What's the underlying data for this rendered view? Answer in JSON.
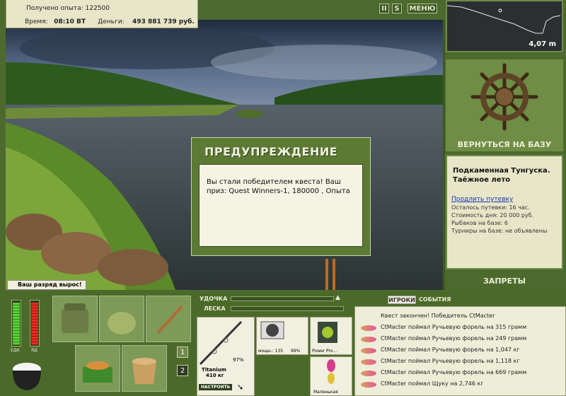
{
  "header": {
    "exp_label": "Получено опыта:",
    "exp_value": "122500",
    "time_label": "Время:",
    "time_value": "08:10 ВТ",
    "money_label": "Деньги:",
    "money_value": "493 881 739 руб."
  },
  "topbar": {
    "pause_icon": "pause-icon",
    "sound_icon": "sound-icon",
    "menu_label": "МЕНЮ"
  },
  "depth": {
    "value": "4,07 m"
  },
  "base": {
    "return_label": "ВЕРНУТЬСЯ НА БАЗУ"
  },
  "location": {
    "name": "Подкаменная Тунгуска. Таёжное лето",
    "extend_link": "Продлить путевку",
    "stats": [
      "Осталось путевки: 16 час.",
      "Стоимость дня: 20 000 руб.",
      "Рыбаков на базе: 6",
      "Турниры на базе: не объявлены"
    ],
    "bans_label": "ЗАПРЕТЫ"
  },
  "dialog": {
    "title": "ПРЕДУПРЕЖДЕНИЕ",
    "message": "Вы стали победителем квеста! Ваш приз: Quest Winners-1, 180000 , Опыта"
  },
  "rank_notice": "Ваш разряд вырос!",
  "gauges": {
    "food_label": "ЕДА",
    "poison_label": "ЯД"
  },
  "pages": [
    "1",
    "2"
  ],
  "rod": {
    "rod_label": "УДОЧКА",
    "line_label": "ЛЕСКА",
    "rod_name": "Titanium",
    "rod_weight": "410 кг",
    "rod_condition": "97%",
    "reel_label": "мощн.: 135",
    "reel_condition": "99%",
    "line_name": "Power Pro...",
    "lure_name": "Маленькая",
    "setup_label": "НАСТРОИТЬ"
  },
  "events": {
    "tabs": [
      "ИГРОКИ",
      "СОБЫТИЯ"
    ],
    "items": [
      "Квест закончен! Победитель CtMacter",
      "CtMacter поймал Ручьевую форель на 315 грамм",
      "CtMacter поймал Ручьевую форель на 249 грамм",
      "CtMacter поймал Ручьевую форель на 1,047 кг",
      "CtMacter поймал Ручьевую форель на 1,118 кг",
      "CtMacter поймал Ручьевую форель на 669 грамм",
      "CtMacter поймал Щуку на 2,746 кг"
    ]
  }
}
